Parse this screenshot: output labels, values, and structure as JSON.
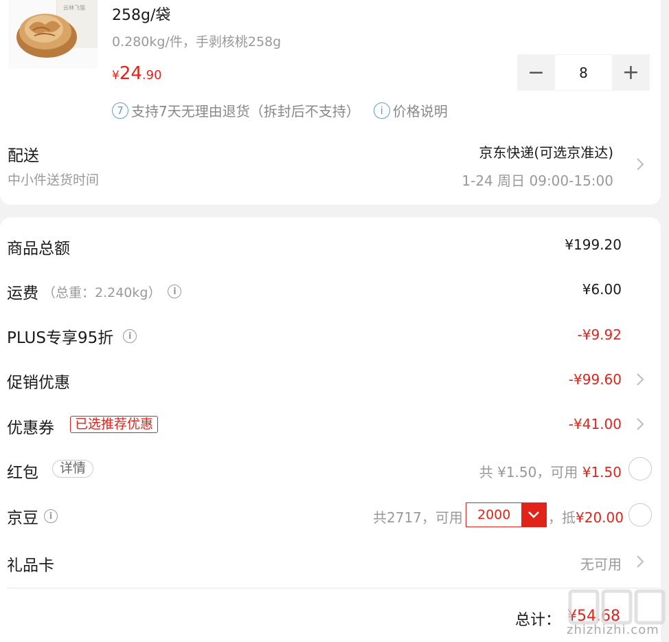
{
  "product": {
    "pack_text": "云林飞猫",
    "title": "258g/袋",
    "spec": "0.280kg/件，手剥核桃258g",
    "price": {
      "currency": "¥",
      "integer": "24",
      "decimal": ".90"
    },
    "quantity": "8",
    "minus_label": "−",
    "plus_label": "+",
    "policy_badge": "7",
    "policy_text": "支持7天无理由退货（拆封后不支持）",
    "price_info_badge": "i",
    "price_info_text": "价格说明"
  },
  "delivery": {
    "label": "配送",
    "sub": "中小件送货时间",
    "method": "京东快递(可选京准达)",
    "time": "1-24 周日 09:00-15:00"
  },
  "summary": {
    "goods_total": {
      "label": "商品总额",
      "value": "¥199.20"
    },
    "shipping": {
      "label": "运费",
      "weight": "（总重：2.240kg）",
      "value": "¥6.00"
    },
    "plus": {
      "label": "PLUS专享95折",
      "value": "-¥9.92"
    },
    "promo": {
      "label": "促销优惠",
      "value": "-¥99.60"
    },
    "coupon": {
      "label": "优惠券",
      "tag": "已选推荐优惠",
      "value": "-¥41.00"
    },
    "redpacket": {
      "label": "红包",
      "detail": "详情",
      "text": "共 ¥1.50，可用 ",
      "value": "¥1.50"
    },
    "jingdou": {
      "label": "京豆",
      "text_prefix": "共2717，可用",
      "selected": "2000",
      "text_mid": "，抵",
      "value": "¥20.00"
    },
    "giftcard": {
      "label": "礼品卡",
      "value": "无可用"
    },
    "total": {
      "label": "总计：",
      "value": "¥54.68"
    }
  },
  "watermark": {
    "text": "zhizhizhi.com"
  },
  "colors": {
    "accent": "#e2231a",
    "info_blue": "#5b9bd5",
    "muted": "#999999"
  },
  "icons": [
    "walnut-product-image",
    "info-icon",
    "chevron-right-icon",
    "chevron-down-icon",
    "radio-circle-icon"
  ]
}
